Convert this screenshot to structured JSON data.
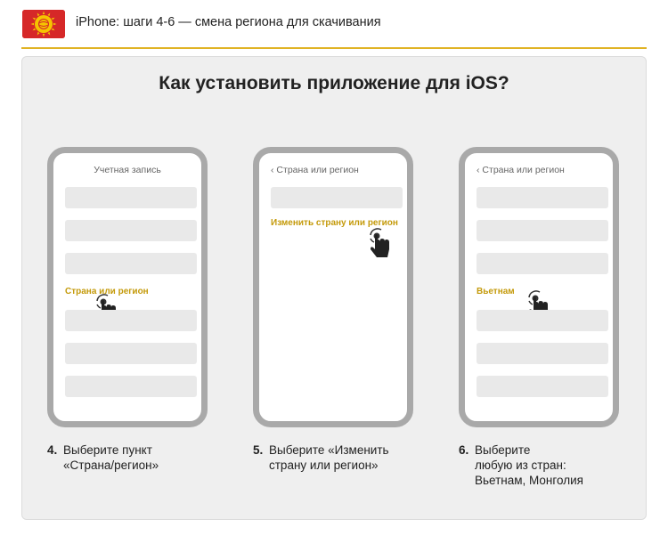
{
  "header": {
    "title": "iPhone: шаги 4-6 — смена региона для скачивания"
  },
  "main": {
    "title": "Как установить приложение для iOS?"
  },
  "phones": [
    {
      "header": "Учетная запись",
      "highlight": "Страна или регион"
    },
    {
      "back_icon": "chevron-left-icon",
      "header": "Страна или регион",
      "highlight": "Изменить страну или регион"
    },
    {
      "back_icon": "chevron-left-icon",
      "header": "Страна или регион",
      "highlight": "Вьетнам"
    }
  ],
  "steps": [
    {
      "number": "4.",
      "line1": "Выберите пункт",
      "line2": "«Страна/регион»"
    },
    {
      "number": "5.",
      "line1": "Выберите «Изменить",
      "line2": "страну или регион»"
    },
    {
      "number": "6.",
      "line1": "Выберите",
      "line2": "любую из стран:",
      "line3": "Вьетнам, Монголия"
    }
  ],
  "colors": {
    "accent": "#c49a0a",
    "divider": "#e0b324",
    "flag_red": "#d62828",
    "flag_sun": "#f5c400"
  }
}
